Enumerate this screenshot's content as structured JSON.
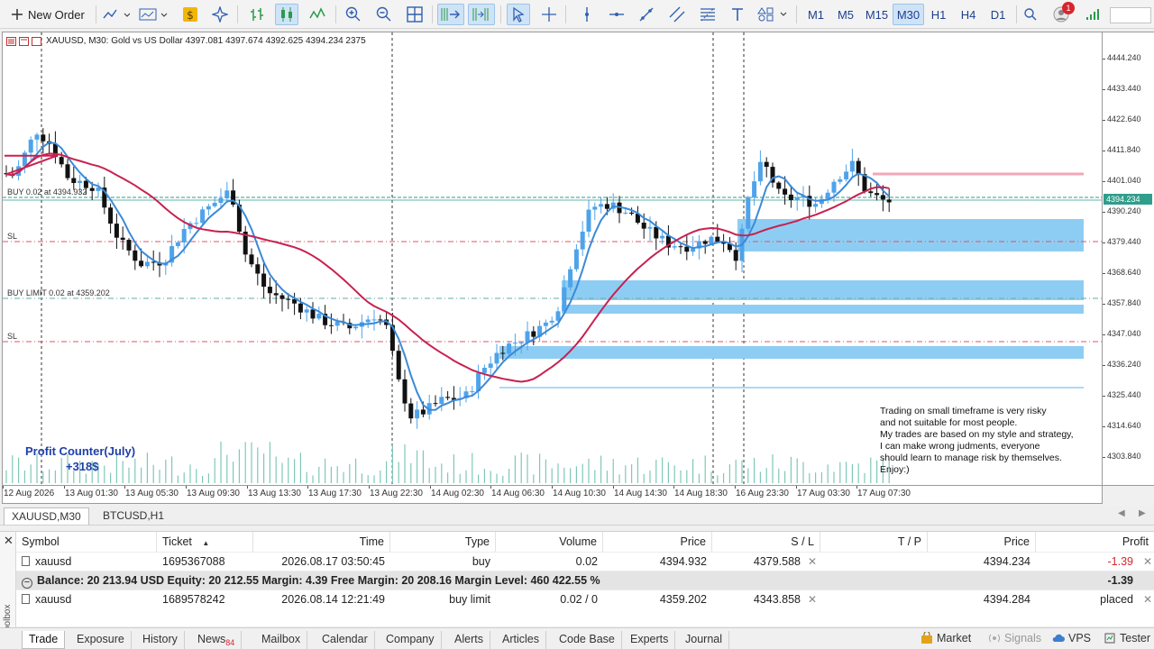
{
  "toolbar": {
    "new_order": "New Order",
    "timeframes": [
      "M1",
      "M5",
      "M15",
      "M30",
      "H1",
      "H4",
      "D1"
    ],
    "active_timeframe": "M30",
    "notifications_count": "1"
  },
  "chart": {
    "title": "XAUUSD, M30:  Gold vs US Dollar  4397.081 4397.674 4392.625 4394.234  2375",
    "profit_counter_title": "Profit Counter(July)",
    "profit_counter_value": "+318$",
    "note_lines": [
      "Trading on small timeframe is very risky",
      "and not suitable for most people.",
      "My trades are based on my style and strategy,",
      "I can make wrong judments, everyone",
      "should learn to manage risk by themselves.",
      "Enjoy:)"
    ],
    "level_labels": {
      "buy": "BUY 0.02 at 4394.932",
      "sl1": "SL",
      "buy_limit": "BUY LIMIT 0.02 at 4359.202",
      "sl2": "SL"
    },
    "current_price_label": "4394.234",
    "price_labels": [
      "4444.240",
      "4433.440",
      "4422.640",
      "4411.840",
      "4401.040",
      "4390.240",
      "4379.440",
      "4368.640",
      "4357.840",
      "4347.040",
      "4336.240",
      "4325.440",
      "4314.640",
      "4303.840"
    ],
    "time_labels": [
      "12 Aug 2026",
      "13 Aug 01:30",
      "13 Aug 05:30",
      "13 Aug 09:30",
      "13 Aug 13:30",
      "13 Aug 17:30",
      "13 Aug 22:30",
      "14 Aug 02:30",
      "14 Aug 06:30",
      "14 Aug 10:30",
      "14 Aug 14:30",
      "14 Aug 18:30",
      "16 Aug 23:30",
      "17 Aug 03:30",
      "17 Aug 07:30"
    ],
    "colors": {
      "bull": "#4ea3ea",
      "bear": "#111111",
      "fast_ma": "#3b8ad8",
      "slow_ma": "#c8214f",
      "zone": "#8ecdf3",
      "tp_line": "#f2a7b7",
      "current": "#2f9e8a",
      "sl_line": "#e0506a",
      "volume": "#7fc8b8"
    }
  },
  "chart_tabs": [
    "XAUUSD,M30",
    "BTCUSD,H1"
  ],
  "trade": {
    "columns": [
      "Symbol",
      "Ticket",
      "Time",
      "Type",
      "Volume",
      "Price",
      "S / L",
      "T / P",
      "Price",
      "Profit"
    ],
    "rows": [
      {
        "symbol": "xauusd",
        "ticket": "1695367088",
        "time": "2026.08.17 03:50:45",
        "type": "buy",
        "volume": "0.02",
        "price": "4394.932",
        "sl": "4379.588",
        "tp": "",
        "cur_price": "4394.234",
        "profit": "-1.39"
      },
      {
        "symbol": "xauusd",
        "ticket": "1689578242",
        "time": "2026.08.14 12:21:49",
        "type": "buy limit",
        "volume": "0.02 / 0",
        "price": "4359.202",
        "sl": "4343.858",
        "tp": "",
        "cur_price": "4394.284",
        "profit": "placed"
      }
    ],
    "balance_text": "Balance: 20 213.94 USD  Equity: 20 212.55  Margin: 4.39  Free Margin: 20 208.16  Margin Level: 460 422.55 %",
    "balance_profit": "-1.39"
  },
  "bottom_tabs": [
    {
      "label": "Trade",
      "badge": ""
    },
    {
      "label": "Exposure",
      "badge": ""
    },
    {
      "label": "History",
      "badge": ""
    },
    {
      "label": "News",
      "badge": "84"
    },
    {
      "label": "Mailbox",
      "badge": ""
    },
    {
      "label": "Calendar",
      "badge": ""
    },
    {
      "label": "Company",
      "badge": ""
    },
    {
      "label": "Alerts",
      "badge": ""
    },
    {
      "label": "Articles",
      "badge": ""
    },
    {
      "label": "Code Base",
      "badge": ""
    },
    {
      "label": "Experts",
      "badge": ""
    },
    {
      "label": "Journal",
      "badge": ""
    }
  ],
  "status": {
    "market": "Market",
    "signals": "Signals",
    "vps": "VPS",
    "tester": "Tester",
    "toolbox": "Toolbox"
  }
}
